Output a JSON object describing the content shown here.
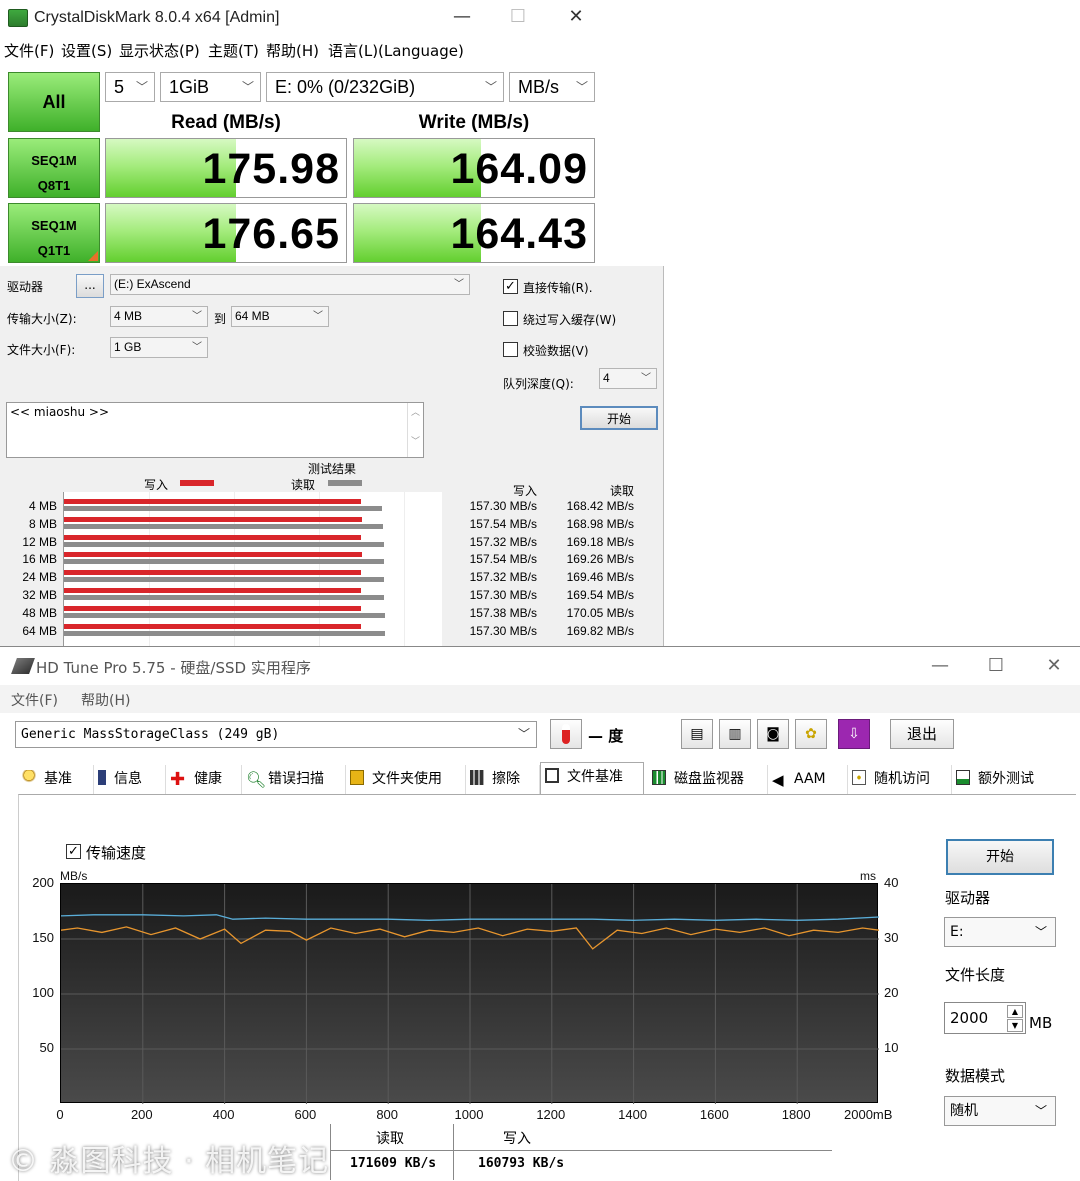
{
  "cdm": {
    "title": "CrystalDiskMark 8.0.4 x64 [Admin]",
    "window_controls": {
      "min": "—",
      "max": "☐",
      "close": "✕"
    },
    "menu": [
      "文件(F)",
      "设置(S)",
      "显示状态(P)",
      "主题(T)",
      "帮助(H)",
      "语言(L)(Language)"
    ],
    "all_label": "All",
    "count": "5",
    "size": "1GiB",
    "drive": "E: 0% (0/232GiB)",
    "unit": "MB/s",
    "read_header": "Read (MB/s)",
    "write_header": "Write (MB/s)",
    "tests": [
      {
        "line1": "SEQ1M",
        "line2": "Q8T1",
        "read": "175.98",
        "write": "164.09"
      },
      {
        "line1": "SEQ1M",
        "line2": "Q1T1",
        "read": "176.65",
        "write": "164.43"
      }
    ],
    "accent": "#63cf2f"
  },
  "fb": {
    "drive_label": "驱动器",
    "browse": "...",
    "drive_value": "(E:) ExAscend",
    "transfer_label": "传输大小(Z):",
    "transfer_from": "4 MB",
    "to_label": "到",
    "transfer_to": "64 MB",
    "filesize_label": "文件大小(F):",
    "filesize_value": "1 GB",
    "direct_io": "直接传输(R).",
    "direct_check": "✓",
    "bypass_cache": "绕过写入缓存(W)",
    "verify": "校验数据(V)",
    "queue_label": "队列深度(Q):",
    "queue_value": "4",
    "start": "开始",
    "memo": "<< miaoshu >>",
    "results_title": "测试结果",
    "legend_write": "写入",
    "legend_read": "读取",
    "col_write": "写入",
    "col_read": "读取",
    "write_color": "#d9262b",
    "read_color": "#8c8c8c",
    "rows": [
      {
        "size": "4 MB",
        "write": "157.30 MB/s",
        "read": "168.42 MB/s"
      },
      {
        "size": "8 MB",
        "write": "157.54 MB/s",
        "read": "168.98 MB/s"
      },
      {
        "size": "12 MB",
        "write": "157.32 MB/s",
        "read": "169.18 MB/s"
      },
      {
        "size": "16 MB",
        "write": "157.54 MB/s",
        "read": "169.26 MB/s"
      },
      {
        "size": "24 MB",
        "write": "157.32 MB/s",
        "read": "169.46 MB/s"
      },
      {
        "size": "32 MB",
        "write": "157.30 MB/s",
        "read": "169.54 MB/s"
      },
      {
        "size": "48 MB",
        "write": "157.38 MB/s",
        "read": "170.05 MB/s"
      },
      {
        "size": "64 MB",
        "write": "157.30 MB/s",
        "read": "169.82 MB/s"
      }
    ]
  },
  "hd": {
    "title": "HD Tune Pro 5.75 - 硬盘/SSD 实用程序",
    "window_controls": {
      "min": "—",
      "max": "☐",
      "close": "✕"
    },
    "menu": [
      "文件(F)",
      "帮助(H)"
    ],
    "drive": "Generic MassStorageClass (249 gB)",
    "temp": "— 度",
    "exit": "退出",
    "tabs": [
      {
        "label": "基准",
        "icon": "benchmark-icon"
      },
      {
        "label": "信息",
        "icon": "info-icon"
      },
      {
        "label": "健康",
        "icon": "health-icon"
      },
      {
        "label": "错误扫描",
        "icon": "error-scan-icon"
      },
      {
        "label": "文件夹使用",
        "icon": "folder-usage-icon"
      },
      {
        "label": "擦除",
        "icon": "erase-icon"
      },
      {
        "label": "文件基准",
        "icon": "file-benchmark-icon"
      },
      {
        "label": "磁盘监视器",
        "icon": "disk-monitor-icon"
      },
      {
        "label": "AAM",
        "icon": "aam-icon"
      },
      {
        "label": "随机访问",
        "icon": "random-access-icon"
      },
      {
        "label": "额外测试",
        "icon": "extra-tests-icon"
      }
    ],
    "transfer_checkbox": "传输速度",
    "transfer_check": "✓",
    "start": "开始",
    "drive_label": "驱动器",
    "drive_value": "E:",
    "file_length_label": "文件长度",
    "file_length_value": "2000",
    "file_length_unit": "MB",
    "data_mode_label": "数据模式",
    "data_mode_value": "随机",
    "results_read_label": "读取",
    "results_write_label": "写入",
    "results_read": "171609 KB/s",
    "results_write": "160793 KB/s",
    "watermark": "© 淼图科技 · 相机笔记",
    "chart_data": {
      "type": "line",
      "ylabel": "MB/s",
      "y2label": "ms",
      "ylim": [
        0,
        200
      ],
      "y2lim": [
        0,
        40
      ],
      "yticks": [
        "200",
        "150",
        "100",
        "50"
      ],
      "y2ticks": [
        "40",
        "30",
        "20",
        "10"
      ],
      "xticks": [
        "0",
        "200",
        "400",
        "600",
        "800",
        "1000",
        "1200",
        "1400",
        "1600",
        "1800",
        "2000mB"
      ],
      "xlim": [
        0,
        2000
      ],
      "grid": true,
      "series": [
        {
          "color": "#5aaed9",
          "x": [
            0,
            80,
            200,
            300,
            380,
            420,
            500,
            600,
            700,
            800,
            900,
            1000,
            1100,
            1200,
            1300,
            1400,
            1500,
            1600,
            1700,
            1800,
            1900,
            2000
          ],
          "values": [
            171,
            172,
            172,
            171,
            172,
            168,
            169,
            168,
            168,
            168,
            167,
            168,
            168,
            168,
            168,
            167,
            168,
            167,
            168,
            167,
            168,
            170
          ]
        },
        {
          "color": "#e8962e",
          "x": [
            0,
            40,
            100,
            160,
            220,
            280,
            340,
            400,
            440,
            500,
            560,
            600,
            660,
            720,
            780,
            840,
            900,
            960,
            1020,
            1080,
            1140,
            1200,
            1260,
            1300,
            1360,
            1420,
            1480,
            1540,
            1600,
            1660,
            1720,
            1780,
            1840,
            1900,
            1960,
            2000
          ],
          "values": [
            158,
            160,
            156,
            161,
            154,
            160,
            150,
            159,
            146,
            158,
            157,
            149,
            160,
            155,
            159,
            152,
            158,
            156,
            160,
            153,
            159,
            157,
            160,
            141,
            158,
            155,
            160,
            154,
            159,
            156,
            160,
            153,
            158,
            156,
            160,
            158
          ]
        }
      ]
    }
  }
}
